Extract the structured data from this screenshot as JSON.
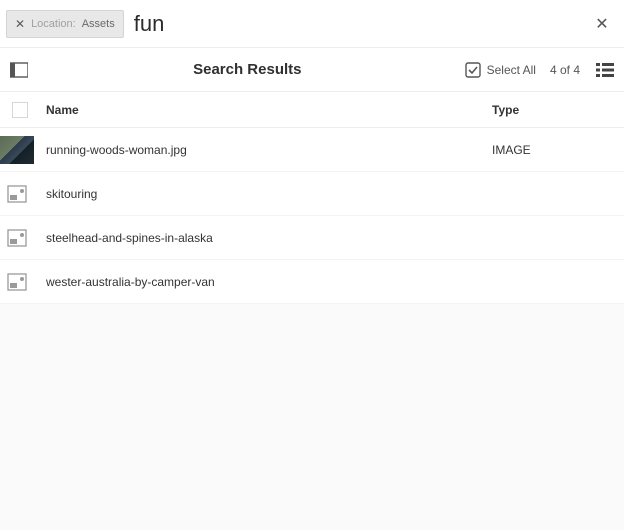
{
  "searchBar": {
    "chip": {
      "key": "Location:",
      "value": "Assets"
    },
    "query": "fun"
  },
  "toolbar": {
    "title": "Search Results",
    "selectAllLabel": "Select All",
    "count": "4 of 4"
  },
  "headers": {
    "name": "Name",
    "type": "Type"
  },
  "results": [
    {
      "thumbKind": "image",
      "name": "running-woods-woman.jpg",
      "type": "IMAGE"
    },
    {
      "thumbKind": "page",
      "name": "skitouring",
      "type": ""
    },
    {
      "thumbKind": "page",
      "name": "steelhead-and-spines-in-alaska",
      "type": ""
    },
    {
      "thumbKind": "page",
      "name": "wester-australia-by-camper-van",
      "type": ""
    }
  ]
}
